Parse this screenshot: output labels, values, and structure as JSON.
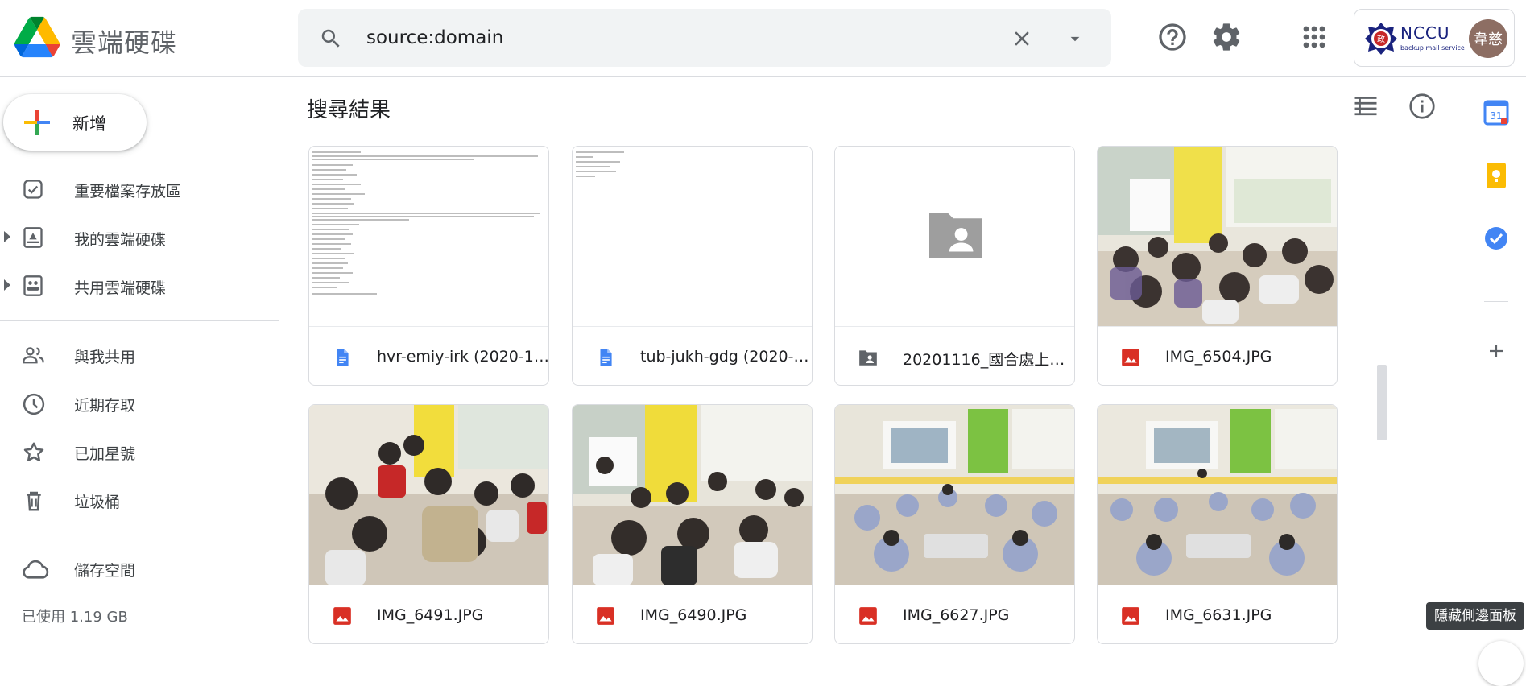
{
  "app": {
    "title": "雲端硬碟",
    "logo_icon": "google-drive-logo"
  },
  "search": {
    "query": "source:domain",
    "icon": "search-icon",
    "clear_icon": "close-icon",
    "options_icon": "arrow-drop-down-icon"
  },
  "header": {
    "icons": [
      "help-icon",
      "settings-icon",
      "apps-grid-icon"
    ],
    "account": {
      "org_name": "NCCU",
      "org_sub": "backup mail service",
      "seal_text": "政",
      "avatar_text": "韋慈",
      "avatar_color": "#8d6e63"
    }
  },
  "sidebar": {
    "new_label": "新增",
    "items": [
      {
        "label": "重要檔案存放區",
        "icon": "priority-check-icon"
      },
      {
        "label": "我的雲端硬碟",
        "icon": "my-drive-icon",
        "expandable": true
      },
      {
        "label": "共用雲端硬碟",
        "icon": "shared-drives-icon",
        "expandable": true
      },
      {
        "label": "與我共用",
        "icon": "shared-with-me-icon"
      },
      {
        "label": "近期存取",
        "icon": "clock-icon"
      },
      {
        "label": "已加星號",
        "icon": "star-icon"
      },
      {
        "label": "垃圾桶",
        "icon": "trash-icon"
      },
      {
        "label": "儲存空間",
        "icon": "cloud-icon"
      }
    ],
    "storage_used": "已使用 1.19 GB"
  },
  "main": {
    "title": "搜尋結果",
    "view_icons": [
      "list-view-icon",
      "info-icon"
    ],
    "files": [
      {
        "name": "hvr-emiy-irk (2020-1…",
        "type": "doc"
      },
      {
        "name": "tub-jukh-gdg (2020-…",
        "type": "doc"
      },
      {
        "name": "20201116_國合處上…",
        "type": "shared-folder"
      },
      {
        "name": "IMG_6504.JPG",
        "type": "image"
      },
      {
        "name": "IMG_6491.JPG",
        "type": "image"
      },
      {
        "name": "IMG_6490.JPG",
        "type": "image"
      },
      {
        "name": "IMG_6627.JPG",
        "type": "image"
      },
      {
        "name": "IMG_6631.JPG",
        "type": "image"
      }
    ]
  },
  "side_panel": {
    "icons": [
      "calendar-icon",
      "keep-icon",
      "tasks-icon",
      "add-icon"
    ],
    "calendar_day": "31",
    "tooltip": "隱藏側邊面板"
  },
  "colors": {
    "blue": "#1a73e8",
    "red": "#d93025",
    "yellow": "#fbbc04",
    "green": "#34a853",
    "doc_blue": "#4285f4",
    "image_red": "#d93025"
  }
}
